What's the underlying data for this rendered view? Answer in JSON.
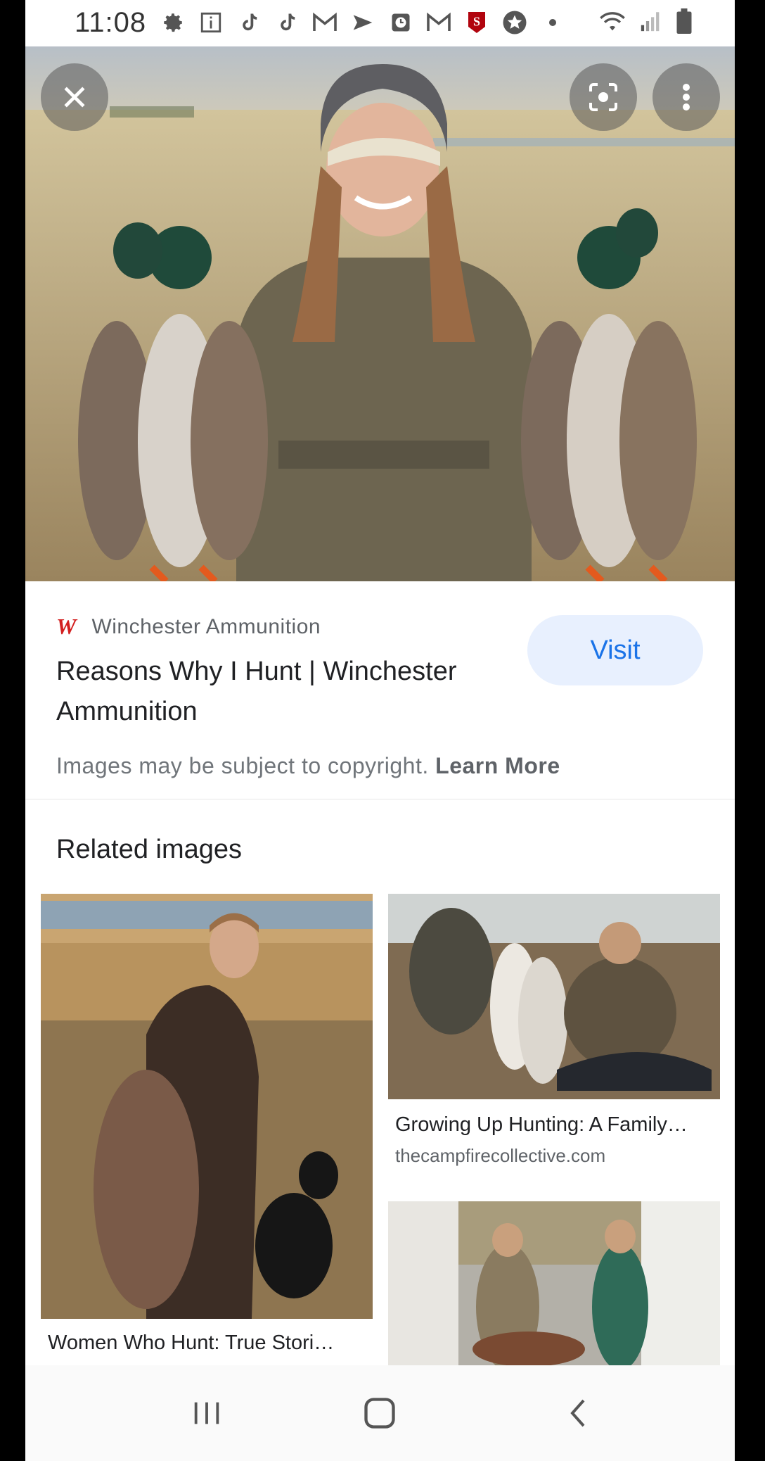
{
  "status_bar": {
    "time": "11:08",
    "notification_icons": [
      "gear-icon",
      "info-icon",
      "tiktok-icon",
      "tiktok-icon",
      "gmail-icon",
      "send-icon",
      "clock-icon",
      "gmail-icon",
      "stanford-icon",
      "star-icon",
      "dot-icon"
    ],
    "system_icons": [
      "wifi-icon",
      "signal-icon",
      "battery-icon"
    ]
  },
  "viewer": {
    "close_icon": "close-icon",
    "lens_icon": "lens-icon",
    "more_icon": "more-vertical-icon"
  },
  "result": {
    "source_logo": "W",
    "source_name": "Winchester Ammunition",
    "title": "Reasons Why I Hunt | Winchester Ammunition",
    "visit_label": "Visit",
    "copyright_text": "Images may be subject to copyright.",
    "learn_more": "Learn More"
  },
  "related": {
    "heading": "Related images",
    "items": [
      {
        "caption": "Women Who Hunt: True Stori…",
        "source": ""
      },
      {
        "caption": "Growing Up Hunting: A Family…",
        "source": "thecampfirecollective.com"
      },
      {
        "caption": "",
        "source": ""
      }
    ]
  },
  "nav": {
    "recents_icon": "recents-icon",
    "home_icon": "home-icon",
    "back_icon": "back-icon"
  }
}
